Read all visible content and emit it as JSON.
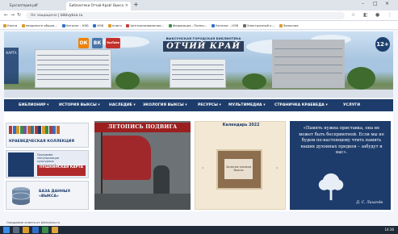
{
  "browser": {
    "tabs": [
      {
        "label": "Бухгалтерия.pdf",
        "active": false
      },
      {
        "label": "Библиотеки Отчий Край! Выкса",
        "active": true
      }
    ],
    "new_tab": "+",
    "address": {
      "security": "Не защищено",
      "url": "biblvyksa.ru"
    },
    "bookmarks": [
      "Книги",
      "неориноте общая…",
      "Каталог - НЭБ",
      "НЭБ",
      "книги",
      "Централизованная…",
      "Федерация - Полна…",
      "Каталог - НЭБ",
      "Электронный к…",
      "Запасник"
    ]
  },
  "header": {
    "social": [
      "ОК",
      "ВК",
      "YouTube"
    ],
    "logo_subtitle": "ВЫКСУНСКАЯ ГОРОДСКАЯ БИБЛИОТЕКА",
    "logo_title": "ОТЧИЙ КРАЙ",
    "age_rating": "12+",
    "side_label": "КАРТА"
  },
  "menu": [
    "БИБЛИОНИР ▾",
    "ИСТОРИЯ ВЫКСЫ ▾",
    "НАСЛЕДИЕ ▾",
    "ЭКОЛОГИЯ ВЫКСЫ ▾",
    "РЕСУРСЫ ▾",
    "МУЛЬТИМЕДИА ▾",
    "СТРАНИЧКА КРАЕВЕДА ▾",
    "УСЛУГИ"
  ],
  "left_column": {
    "kraeved": "КРАЕВЕДЧЕСКАЯ КОЛЛЕКЦИЯ",
    "pushkin_lines": [
      "Программа",
      "популяризации",
      "культурных",
      "мероприятий"
    ],
    "pushkin_card": "ПУШКИНСКАЯ КАРТА",
    "database": "БАЗА ДАННЫХ «ВЫКСА»"
  },
  "story": {
    "title": "ЛЕТОПИСЬ ПОДВИГА"
  },
  "calendar": {
    "title": "Календарь 2022",
    "inner": "Золотые книжки Выксы"
  },
  "quote": {
    "text": "«Память нужна приставка, она не может быть бесприютной. Если мы не будем по-настоящему чтить память наших духовных предков – забудут и нас».",
    "author": "Д. С. Лихачёв"
  },
  "status": "Ожидание ответа от biblvyksa.ru",
  "taskbar": {
    "time": "14:36"
  },
  "colors": {
    "menu": "#1d3c6b",
    "accent": "#9c1f1f"
  }
}
